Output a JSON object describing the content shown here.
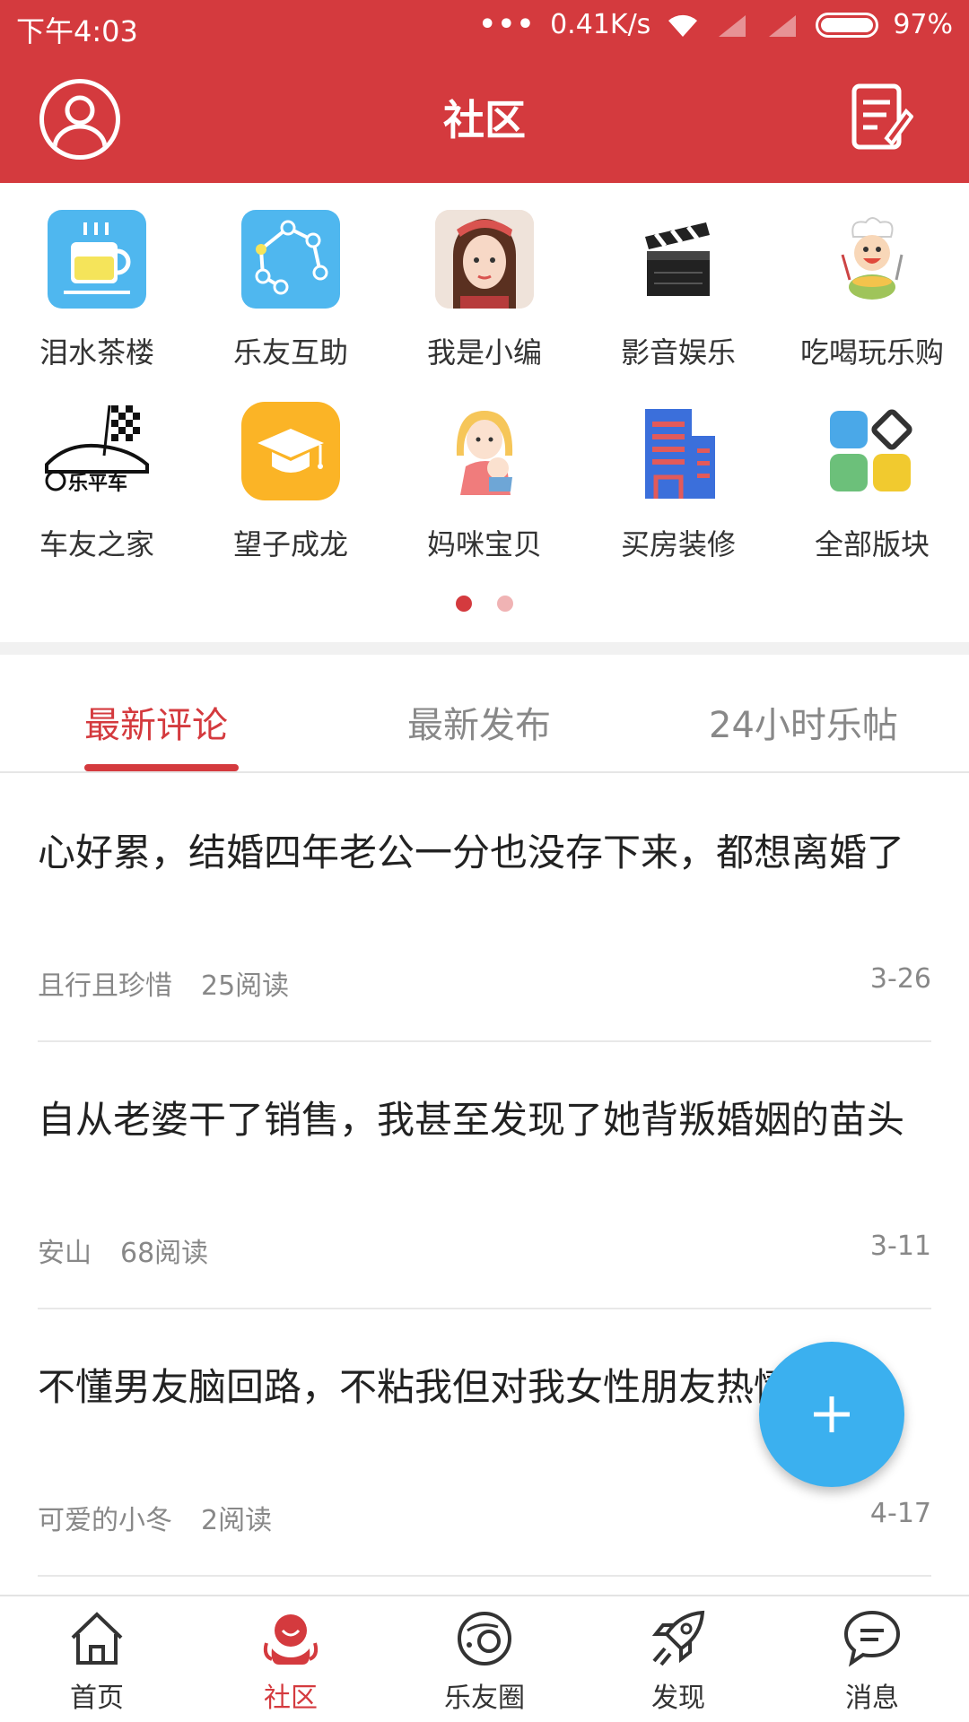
{
  "status_bar": {
    "time": "下午4:03",
    "network_speed": "0.41K/s",
    "battery": "97%"
  },
  "header": {
    "title": "社区"
  },
  "categories": [
    {
      "label": "泪水茶楼",
      "icon": "tea-cup-icon"
    },
    {
      "label": "乐友互助",
      "icon": "network-nodes-icon"
    },
    {
      "label": "我是小编",
      "icon": "girl-avatar-icon"
    },
    {
      "label": "影音娱乐",
      "icon": "clapperboard-icon"
    },
    {
      "label": "吃喝玩乐购",
      "icon": "chef-boy-icon"
    },
    {
      "label": "车友之家",
      "icon": "racing-car-logo-icon",
      "logo_text": "乐平车"
    },
    {
      "label": "望子成龙",
      "icon": "graduation-cap-icon"
    },
    {
      "label": "妈咪宝贝",
      "icon": "mother-baby-icon"
    },
    {
      "label": "买房装修",
      "icon": "building-icon"
    },
    {
      "label": "全部版块",
      "icon": "all-sections-grid-icon"
    }
  ],
  "tabs": [
    {
      "label": "最新评论",
      "active": true
    },
    {
      "label": "最新发布",
      "active": false
    },
    {
      "label": "24小时乐帖",
      "active": false
    }
  ],
  "posts": [
    {
      "title": "心好累，结婚四年老公一分也没存下来，都想离婚了",
      "author": "且行且珍惜",
      "reads": "25阅读",
      "date": "3-26"
    },
    {
      "title": "自从老婆干了销售，我甚至发现了她背叛婚姻的苗头",
      "author": "安山",
      "reads": "68阅读",
      "date": "3-11"
    },
    {
      "title": "不懂男友脑回路，不粘我但对我女性朋友热情？",
      "author": "可爱的小冬",
      "reads": "2阅读",
      "date": "4-17"
    }
  ],
  "bottom_nav": [
    {
      "label": "首页",
      "icon": "home-icon",
      "active": false
    },
    {
      "label": "社区",
      "icon": "community-icon",
      "active": true
    },
    {
      "label": "乐友圈",
      "icon": "planet-icon",
      "active": false
    },
    {
      "label": "发现",
      "icon": "rocket-icon",
      "active": false
    },
    {
      "label": "消息",
      "icon": "chat-bubble-icon",
      "active": false
    }
  ],
  "colors": {
    "primary": "#d43a3e",
    "fab": "#3bb0ef"
  }
}
